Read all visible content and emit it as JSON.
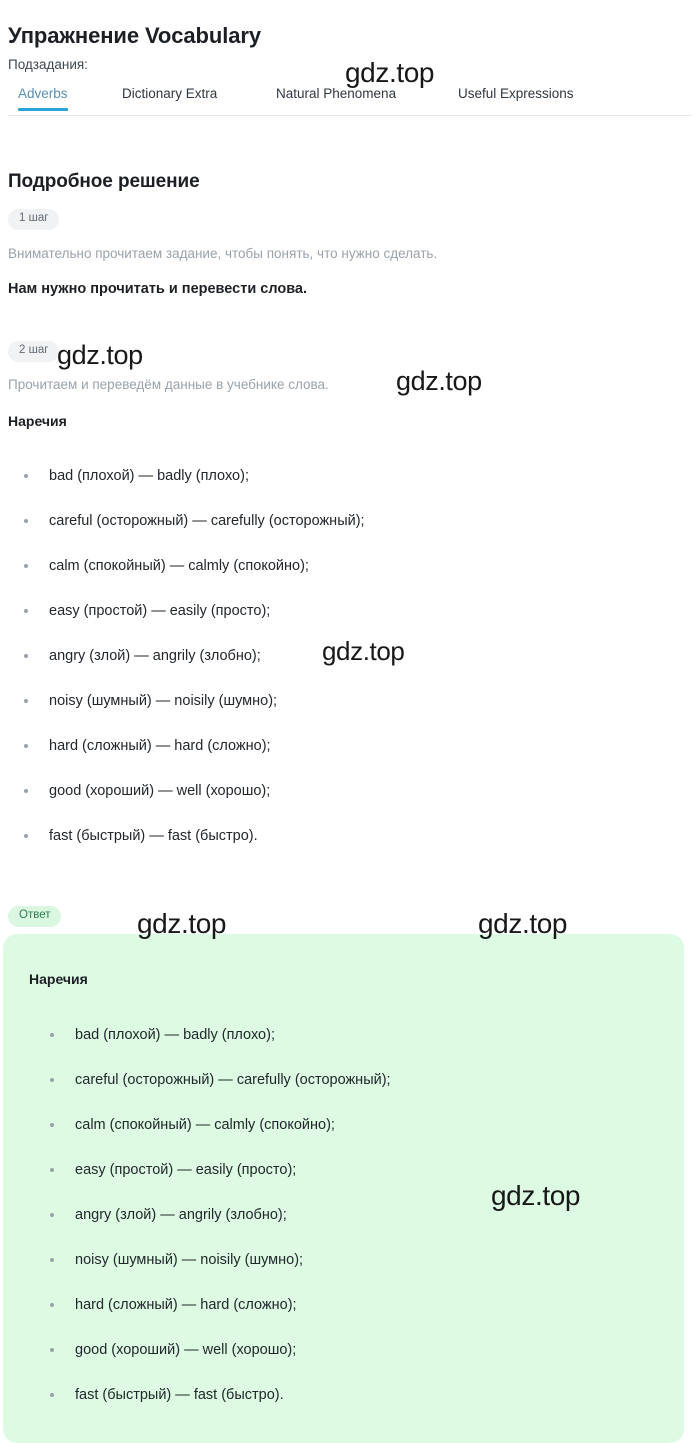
{
  "header": {
    "title": "Упражнение Vocabulary",
    "subtasks_label": "Подзадания:"
  },
  "tabs": [
    {
      "label": "Adverbs",
      "active": true
    },
    {
      "label": "Dictionary Extra",
      "active": false
    },
    {
      "label": "Natural Phenomena",
      "active": false
    },
    {
      "label": "Useful Expressions",
      "active": false
    }
  ],
  "solution": {
    "heading": "Подробное решение",
    "steps": [
      {
        "badge": "1 шаг",
        "text": "Внимательно прочитаем задание, чтобы понять, что нужно сделать.",
        "conclusion": "Нам нужно прочитать и перевести слова."
      },
      {
        "badge": "2 шаг",
        "text": "Прочитаем и переведём данные в учебнике слова.",
        "subtitle": "Наречия"
      }
    ],
    "words": [
      "bad (плохой) — badly (плохо);",
      "careful (осторожный) — carefully (осторожный);",
      "calm (спокойный) — calmly (спокойно);",
      "easy (простой) — easily (просто);",
      "angry (злой) — angrily (злобно);",
      "noisy (шумный) — noisily (шумно);",
      "hard (сложный) — hard (сложно);",
      "good (хороший) — well (хорошо);",
      "fast (быстрый) — fast (быстро)."
    ]
  },
  "answer": {
    "badge": "Ответ",
    "subtitle": "Наречия",
    "words": [
      "bad (плохой) — badly (плохо);",
      "careful (осторожный) — carefully (осторожный);",
      "calm (спокойный) — calmly (спокойно);",
      "easy (простой) — easily (просто);",
      "angry (злой) — angrily (злобно);",
      "noisy (шумный) — noisily (шумно);",
      "hard (сложный) — hard (сложно);",
      "good (хороший) — well (хорошо);",
      "fast (быстрый) — fast (быстро)."
    ]
  },
  "watermarks": [
    "gdz.top",
    "gdz.top",
    "gdz.top",
    "gdz.top",
    "gdz.top",
    "gdz.top",
    "gdz.top"
  ],
  "colors": {
    "accent_blue": "#29a3d9",
    "active_tab_text": "#5b8fb5",
    "answer_bg": "#ddfbe3",
    "answer_badge_bg": "#d9f7e1",
    "answer_badge_text": "#2e7d4f",
    "step_badge_bg": "#f1f2f4",
    "muted_text": "#9aa2ab",
    "body_text": "#22272c"
  }
}
